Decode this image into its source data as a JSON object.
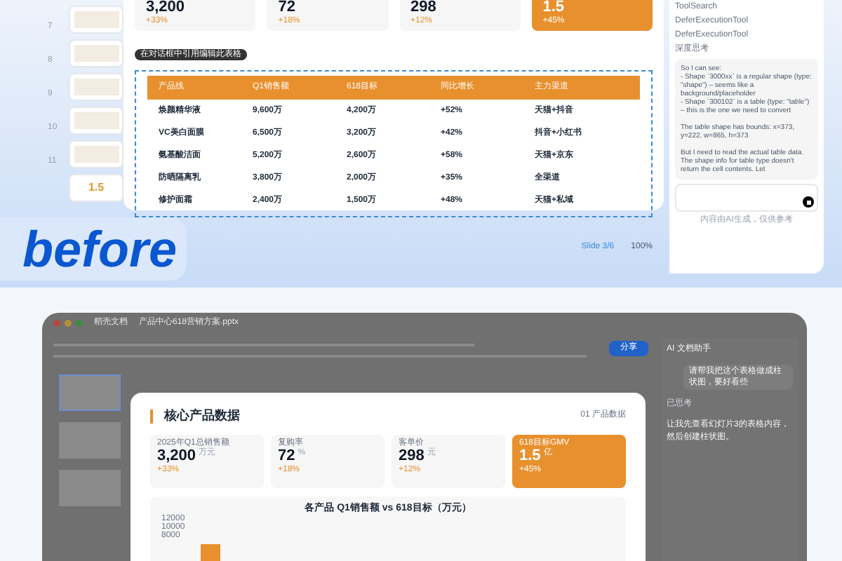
{
  "before": {
    "thumbnails": [
      {
        "number": "7"
      },
      {
        "number": "8"
      },
      {
        "number": "9"
      },
      {
        "number": "10"
      },
      {
        "number": "11"
      },
      {
        "value": "1.5"
      }
    ],
    "stat_cards": [
      {
        "value": "3,200",
        "delta": "+33%",
        "highlighted": false
      },
      {
        "value": "72",
        "delta": "+18%",
        "highlighted": false
      },
      {
        "value": "298",
        "delta": "+12%",
        "highlighted": false
      },
      {
        "value": "1.5",
        "delta": "+45%",
        "highlighted": true
      }
    ],
    "tooltip": "在对话框中引用编辑此表格",
    "table": {
      "columns": [
        "产品线",
        "Q1销售额",
        "618目标",
        "同比增长",
        "主力渠道"
      ],
      "rows": [
        [
          "焕颜精华液",
          "9,600万",
          "4,200万",
          "+52%",
          "天猫+抖音"
        ],
        [
          "VC美白面膜",
          "6,500万",
          "3,200万",
          "+42%",
          "抖音+小红书"
        ],
        [
          "氨基酸洁面",
          "5,200万",
          "2,600万",
          "+58%",
          "天猫+京东"
        ],
        [
          "防晒隔离乳",
          "3,800万",
          "2,000万",
          "+35%",
          "全渠道"
        ],
        [
          "修护面霜",
          "2,400万",
          "1,500万",
          "+48%",
          "天猫+私域"
        ]
      ]
    },
    "status_bar": {
      "slide": "Slide 3/6",
      "zoom": "100%"
    },
    "chat": {
      "tools": [
        "ToolSearch",
        "DeferExecutionTool",
        "DeferExecutionTool"
      ],
      "thinking": "深度思考",
      "message": "So I can see:\n- Shape `3000xx` is a regular shape (type: \"shape\") – seems like a background/placeholder\n- Shape `300102` is a table (type: \"table\") – this is the one we need to convert\n\nThe table shape has bounds: x=373, y=222, w=865, h=373\n\nBut I need to read the actual table data. The shape info for table type doesn't return the cell contents. Let",
      "footer": "内容由AI生成，仅供参考"
    },
    "label": "before"
  },
  "after": {
    "window_tabs": [
      "稻壳文档",
      "产品中心618营销方案.pptx"
    ],
    "share_button": "分享",
    "assistant": {
      "title": "AI 文档助手",
      "user_message": "请帮我把这个表格做成柱状图，要好看些",
      "status": "已思考",
      "reply": "让我先查看幻灯片3的表格内容，然后创建柱状图。"
    },
    "slide": {
      "title": "核心产品数据",
      "section": "01 产品数据",
      "stat_cards": [
        {
          "label": "2025年Q1总销售额",
          "value": "3,200",
          "unit": "万元",
          "delta": "+33%",
          "highlighted": false
        },
        {
          "label": "复购率",
          "value": "72",
          "unit": "%",
          "delta": "+18%",
          "highlighted": false
        },
        {
          "label": "客单价",
          "value": "298",
          "unit": "元",
          "delta": "+12%",
          "highlighted": false
        },
        {
          "label": "618目标GMV",
          "value": "1.5",
          "unit": "亿",
          "delta": "+45%",
          "highlighted": true
        }
      ],
      "chart_title": "各产品 Q1销售额 vs 618目标（万元）",
      "y_ticks": [
        "12000",
        "10000",
        "8000"
      ]
    }
  }
}
